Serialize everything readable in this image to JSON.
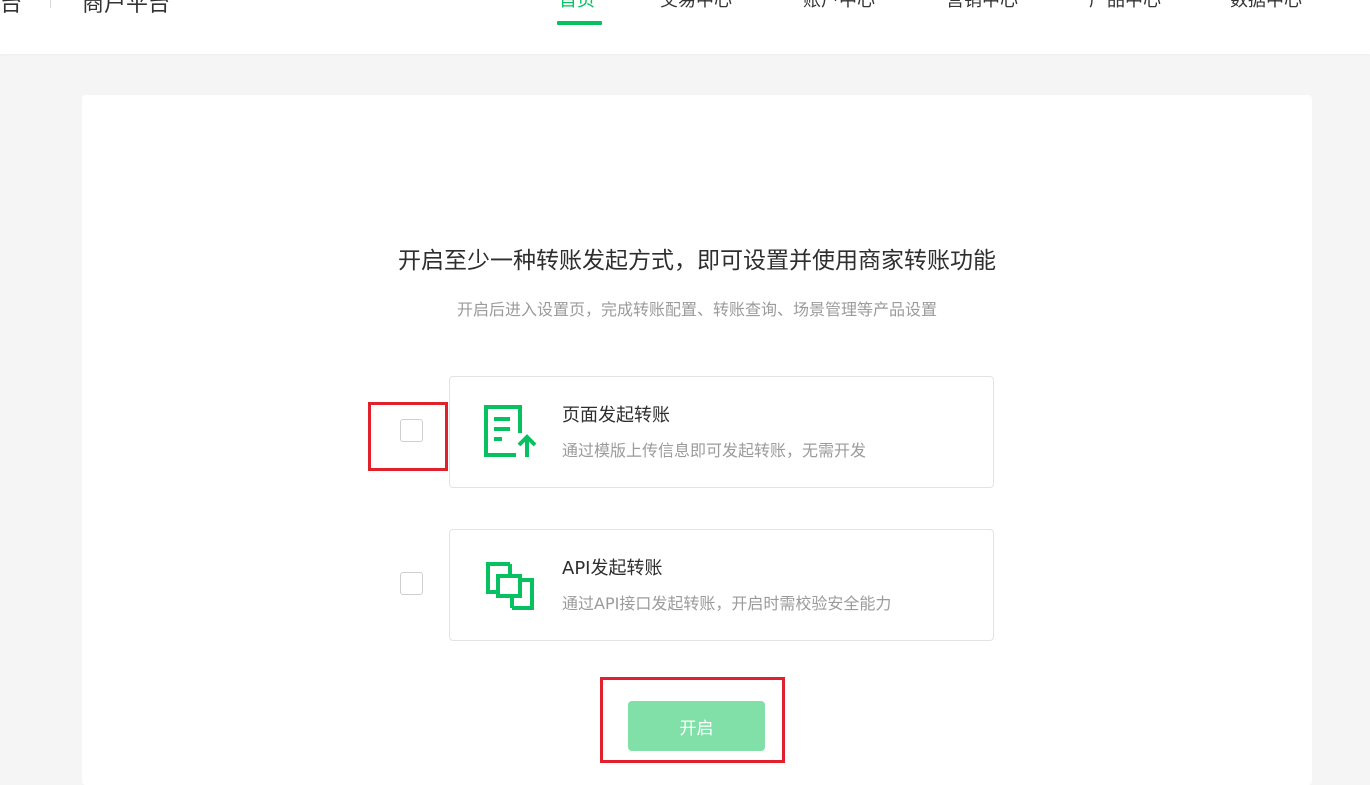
{
  "header": {
    "brand_tail": "台",
    "brand_name": "商户平台",
    "nav": [
      {
        "label": "首页",
        "active": true
      },
      {
        "label": "交易中心",
        "active": false
      },
      {
        "label": "账户中心",
        "active": false
      },
      {
        "label": "营销中心",
        "active": false
      },
      {
        "label": "产品中心",
        "active": false
      },
      {
        "label": "数据中心",
        "active": false
      }
    ]
  },
  "main": {
    "headline": "开启至少一种转账发起方式，即可设置并使用商家转账功能",
    "subline": "开启后进入设置页，完成转账配置、转账查询、场景管理等产品设置",
    "options": [
      {
        "title": "页面发起转账",
        "desc": "通过模版上传信息即可发起转账，无需开发",
        "icon": "document-upload-icon",
        "checked": false
      },
      {
        "title": "API发起转账",
        "desc": "通过API接口发起转账，开启时需校验安全能力",
        "icon": "api-link-icon",
        "checked": false
      }
    ],
    "enable_label": "开启"
  },
  "colors": {
    "accent": "#07c160",
    "button_disabled": "#80e0a8",
    "annotation": "#e0212b"
  }
}
